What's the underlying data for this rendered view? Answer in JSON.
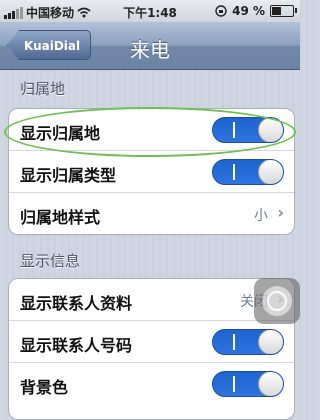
{
  "statusbar": {
    "carrier": "中国移动",
    "time": "下午1:48",
    "battery_text": "49 %",
    "battery_level": 0.49
  },
  "navbar": {
    "back_label": "KuaiDial",
    "title": "来电"
  },
  "sections": [
    {
      "header": "归属地",
      "rows": [
        {
          "label": "显示归属地",
          "type": "toggle",
          "state": "on"
        },
        {
          "label": "显示归属类型",
          "type": "toggle",
          "state": "on"
        },
        {
          "label": "归属地样式",
          "type": "disclosure",
          "value": "小"
        }
      ]
    },
    {
      "header": "显示信息",
      "rows": [
        {
          "label": "显示联系人资料",
          "type": "disclosure",
          "value": "关闭"
        },
        {
          "label": "显示联系人号码",
          "type": "toggle",
          "state": "on"
        },
        {
          "label": "背景色",
          "type": "toggle",
          "state": "on"
        }
      ]
    }
  ],
  "colors": {
    "toggle_on": "#2f74e0",
    "highlight": "#6fc04c",
    "navbar": "#7f96b6"
  },
  "icons": [
    "signal-bars-icon",
    "wifi-icon",
    "lock-rotation-icon",
    "battery-icon",
    "chevron-right-icon",
    "assistive-touch-icon"
  ]
}
